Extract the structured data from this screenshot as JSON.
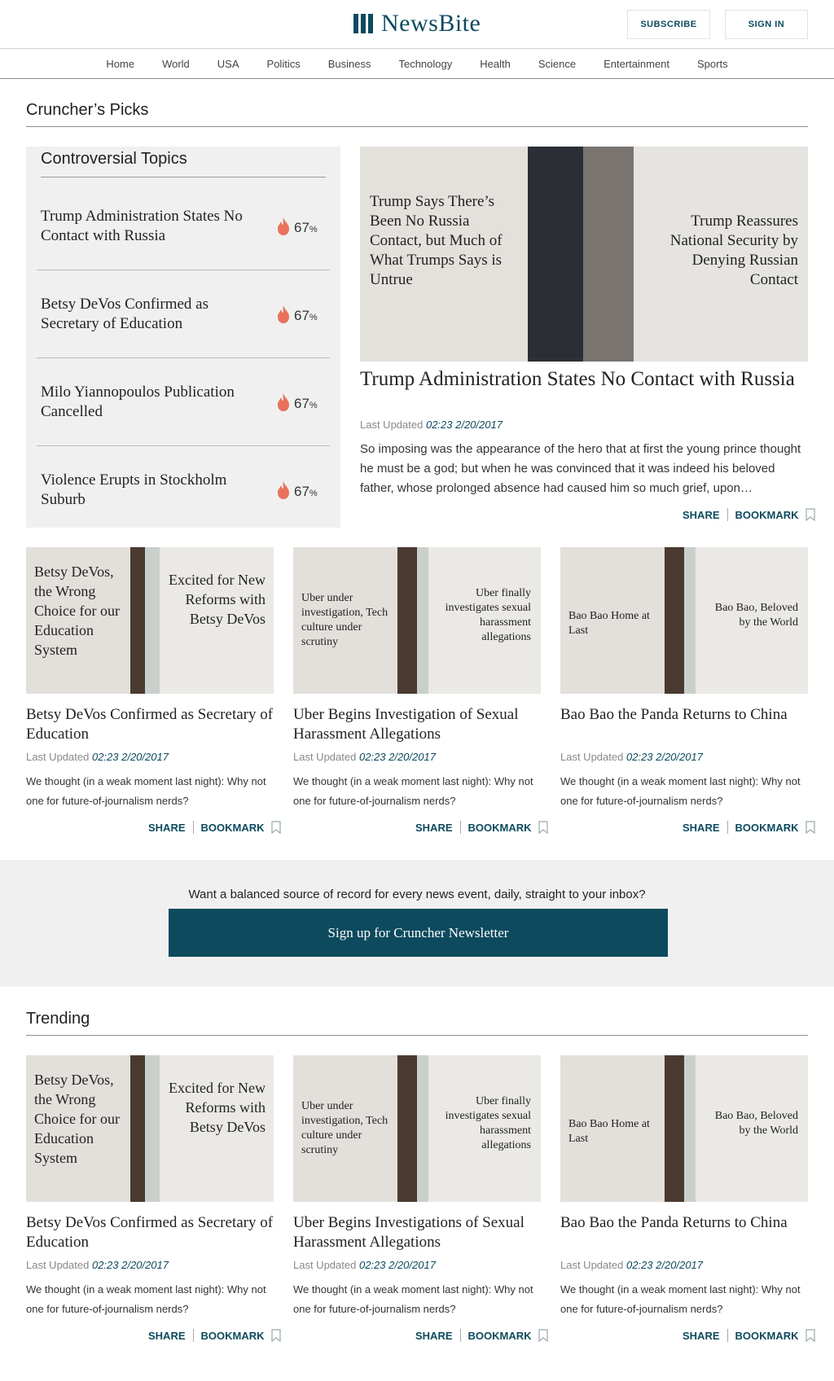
{
  "brand": {
    "name": "NewsBite",
    "color": "#0d4a5e"
  },
  "header": {
    "subscribe": "SUBSCRIBE",
    "sign_in": "SIGN IN"
  },
  "nav": [
    "Home",
    "World",
    "USA",
    "Politics",
    "Business",
    "Technology",
    "Health",
    "Science",
    "Entertainment",
    "Sports"
  ],
  "picks": {
    "title": "Cruncher’s Picks",
    "controversial": {
      "title": "Controversial Topics",
      "icon": "flame-icon",
      "items": [
        {
          "text": "Trump Administration States No Contact with Russia",
          "pct": "67",
          "unit": "%"
        },
        {
          "text": "Betsy DeVos Confirmed as Secretary of Education",
          "pct": "67",
          "unit": "%"
        },
        {
          "text": "Milo Yiannopoulos Publication Cancelled",
          "pct": "67",
          "unit": "%"
        },
        {
          "text": "Violence Erupts in Stockholm Suburb",
          "pct": "67",
          "unit": "%"
        }
      ]
    },
    "feature": {
      "overlay_left": "Trump Says There’s Been No Russia Contact, but Much of What Trumps Says is Untrue",
      "overlay_right": "Trump Reassures National Security by Denying Russian Contact",
      "title": "Trump Administration States No Contact with Russia",
      "updated_label": "Last Updated",
      "updated_time": "02:23 2/20/2017",
      "body": "So imposing was the appearance of the hero that at first the young prince thought he must be a god; but when he was convinced that it was indeed his beloved father, whose prolonged absence had caused him so much grief, upon…",
      "share": "SHARE",
      "bookmark": "BOOKMARK"
    },
    "cards": [
      {
        "overlay_left": "Betsy DeVos, the Wrong Choice for our Education System",
        "overlay_right": "Excited for New Reforms with Betsy DeVos",
        "title": "Betsy DeVos Confirmed as Secretary of Education",
        "updated_label": "Last Updated",
        "updated_time": "02:23 2/20/2017",
        "body": "We thought (in a weak moment last night): Why not one for future-of-journalism nerds?",
        "share": "SHARE",
        "bookmark": "BOOKMARK"
      },
      {
        "overlay_left": "Uber under investigation, Tech culture under scrutiny",
        "overlay_right": "Uber finally investigates sexual harassment allegations",
        "title": "Uber Begins Investigation of Sexual Harassment Allegations",
        "updated_label": "Last Updated",
        "updated_time": "02:23 2/20/2017",
        "body": "We thought (in a weak moment last night): Why not one for future-of-journalism nerds?",
        "share": "SHARE",
        "bookmark": "BOOKMARK"
      },
      {
        "overlay_left": "Bao Bao Home at Last",
        "overlay_right": "Bao Bao, Beloved by the World",
        "title": "Bao Bao the Panda Returns to China",
        "updated_label": "Last Updated",
        "updated_time": "02:23 2/20/2017",
        "body": "We thought (in a weak moment last night): Why not one for future-of-journalism nerds?",
        "share": "SHARE",
        "bookmark": "BOOKMARK"
      }
    ]
  },
  "newsletter": {
    "question": "Want a balanced source of record for every news event, daily, straight to your inbox?",
    "button": "Sign up for Cruncher Newsletter"
  },
  "trending": {
    "title": "Trending",
    "cards": [
      {
        "overlay_left": "Betsy DeVos, the Wrong Choice for our Education System",
        "overlay_right": "Excited for New Reforms with Betsy DeVos",
        "title": "Betsy DeVos Confirmed as Secretary of Education",
        "updated_label": "Last Updated",
        "updated_time": "02:23 2/20/2017",
        "body": "We thought (in a weak moment last night): Why not one for future-of-journalism nerds?",
        "share": "SHARE",
        "bookmark": "BOOKMARK"
      },
      {
        "overlay_left": "Uber under investigation, Tech culture under scrutiny",
        "overlay_right": "Uber finally investigates sexual harassment allegations",
        "title": "Uber Begins Investigations of Sexual Harassment Allegations",
        "updated_label": "Last Updated",
        "updated_time": "02:23 2/20/2017",
        "body": "We thought (in a weak moment last night): Why not one for future-of-journalism nerds?",
        "share": "SHARE",
        "bookmark": "BOOKMARK"
      },
      {
        "overlay_left": "Bao Bao Home at Last",
        "overlay_right": "Bao Bao, Beloved by the World",
        "title": "Bao Bao the Panda Returns to China",
        "updated_label": "Last Updated",
        "updated_time": "02:23 2/20/2017",
        "body": "We thought (in a weak moment last night): Why not one for future-of-journalism nerds?",
        "share": "SHARE",
        "bookmark": "BOOKMARK"
      }
    ]
  }
}
